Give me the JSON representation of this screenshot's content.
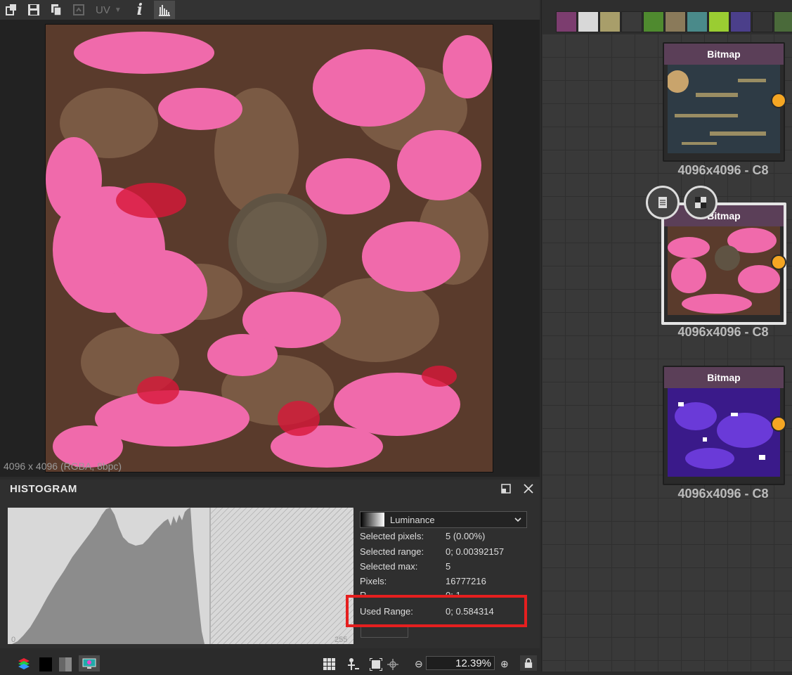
{
  "toolbar": {
    "uv_label": "UV",
    "info_label": "i"
  },
  "viewer": {
    "image_info": "4096 x 4096 (RGBA, 8bpc)"
  },
  "histogram": {
    "title": "HISTOGRAM",
    "axis_min": "0",
    "axis_max": "255",
    "channel": "Luminance",
    "stats": [
      {
        "label": "Selected pixels:",
        "value": "5 (0.00%)"
      },
      {
        "label": "Selected range:",
        "value": "0; 0.00392157"
      },
      {
        "label": "Selected max:",
        "value": "5"
      },
      {
        "label": "Pixels:",
        "value": "16777216"
      },
      {
        "label": "R",
        "value": "0; 1"
      },
      {
        "label": "Used Range:",
        "value": "0; 0.584314"
      }
    ],
    "highlight_color": "#e51f1f"
  },
  "statusbar": {
    "zoom": "12.39%"
  },
  "graph": {
    "nodes": [
      {
        "title": "Bitmap",
        "label": "4096x4096 - C8"
      },
      {
        "title": "Bitmap",
        "label": "4096x4096 - C8"
      },
      {
        "title": "Bitmap",
        "label": "4096x4096 - C8"
      }
    ],
    "port_color": "#f5a623",
    "node_header_color": "#5b3f58"
  }
}
